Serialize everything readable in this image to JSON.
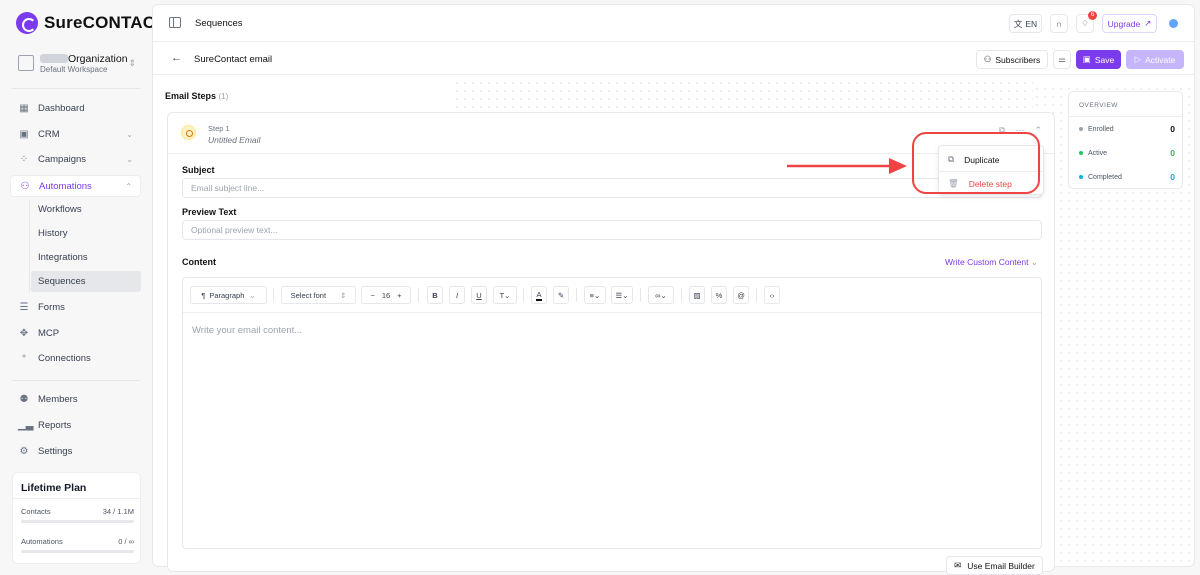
{
  "brand": {
    "logo_text": "SureCONTACT",
    "accent": "#7c3aed"
  },
  "org": {
    "name": "Organization",
    "workspace": "Default Workspace"
  },
  "sidebar": {
    "items": [
      {
        "label": "Dashboard",
        "icon": "grid-icon"
      },
      {
        "label": "CRM",
        "icon": "contact-card-icon"
      },
      {
        "label": "Campaigns",
        "icon": "campaigns-icon"
      },
      {
        "label": "Automations",
        "icon": "automation-icon"
      },
      {
        "label": "Forms",
        "icon": "forms-icon"
      },
      {
        "label": "MCP",
        "icon": "mcp-icon"
      },
      {
        "label": "Connections",
        "icon": "connections-icon"
      },
      {
        "label": "Members",
        "icon": "members-icon"
      },
      {
        "label": "Reports",
        "icon": "reports-icon"
      },
      {
        "label": "Settings",
        "icon": "gear-icon"
      }
    ],
    "automation_sub": [
      "Workflows",
      "History",
      "Integrations",
      "Sequences"
    ],
    "active_sub": "Sequences"
  },
  "plan": {
    "title": "Lifetime Plan",
    "contacts_label": "Contacts",
    "contacts_value": "34 / 1.1M",
    "automations_label": "Automations",
    "automations_value": "0 / ∞"
  },
  "topbar": {
    "breadcrumb": "Sequences",
    "lang": "EN",
    "notification_count": "6",
    "upgrade_label": "Upgrade"
  },
  "subbar": {
    "title": "SureContact email",
    "subscribers_label": "Subscribers",
    "save_label": "Save",
    "activate_label": "Activate"
  },
  "steps": {
    "label": "Email Steps",
    "count": "(1)",
    "step_number": "Step 1",
    "step_name": "Untitled Email"
  },
  "menu": {
    "duplicate_label": "Duplicate",
    "delete_label": "Delete step"
  },
  "form": {
    "subject_label": "Subject",
    "subject_placeholder": "Email subject line...",
    "preview_label": "Preview Text",
    "preview_placeholder": "Optional preview text...",
    "content_label": "Content",
    "custom_content_label": "Write Custom Content",
    "editor_placeholder": "Write your email content...",
    "use_builder_label": "Use Email Builder"
  },
  "toolbar": {
    "paragraph": "Paragraph",
    "font": "Select font",
    "font_size": "16"
  },
  "overview": {
    "title": "OVERVIEW",
    "rows": [
      {
        "label": "Enrolled",
        "value": "0",
        "color": "#9ca3af"
      },
      {
        "label": "Active",
        "value": "0",
        "color": "#22c55e"
      },
      {
        "label": "Completed",
        "value": "0",
        "color": "#06b6d4"
      }
    ]
  }
}
